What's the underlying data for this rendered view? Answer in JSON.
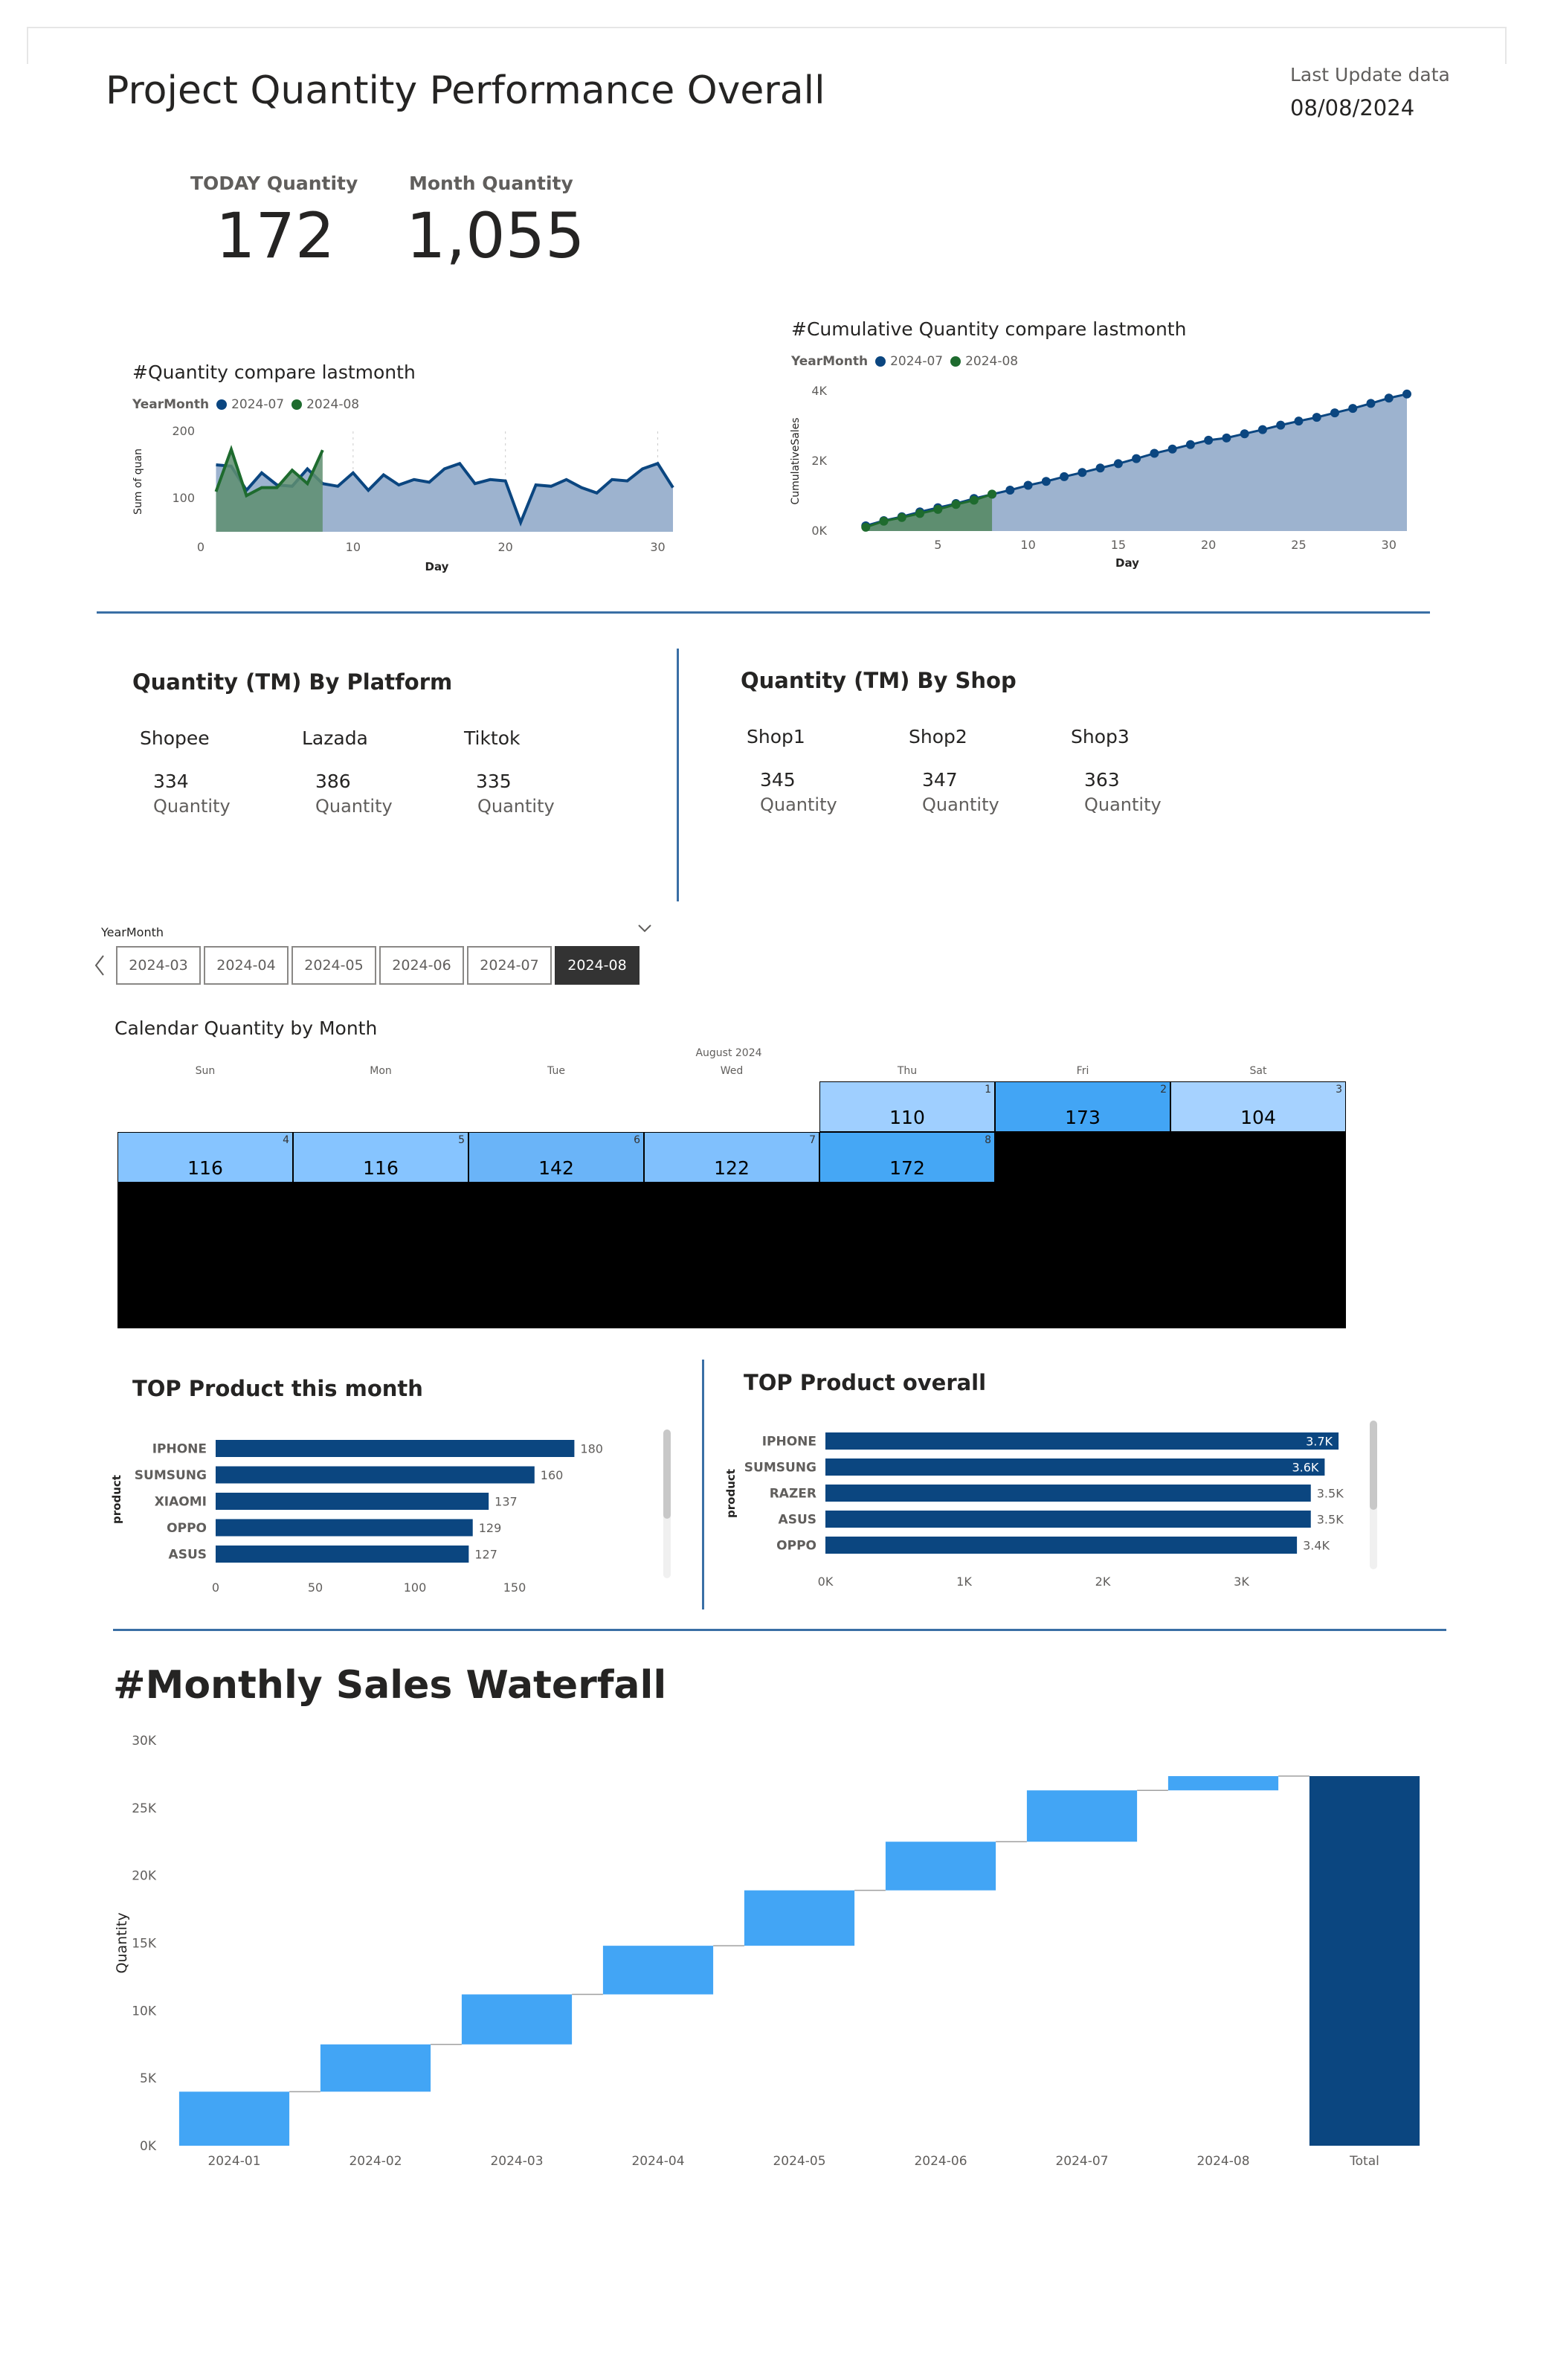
{
  "header": {
    "title": "Project Quantity Performance Overall",
    "last_update_label": "Last Update data",
    "last_update_value": "08/08/2024"
  },
  "kpis": {
    "today_label": "TODAY Quantity",
    "today_value": "172",
    "month_label": "Month Quantity",
    "month_value": "1,055"
  },
  "legend": {
    "label": "YearMonth",
    "series1": "2024-07",
    "series2": "2024-08"
  },
  "colors": {
    "dark_blue": "#0b4680",
    "green": "#1e6b2e",
    "light_fill": "#9db3cf",
    "bright_blue": "#42a5f5",
    "divider": "#3a6fa5"
  },
  "chart_data": [
    {
      "type": "line",
      "title": "#Quantity compare lastmonth",
      "xlabel": "Day",
      "ylabel": "Sum of quan",
      "xlim": [
        0,
        31
      ],
      "ylim": [
        50,
        200
      ],
      "xticks": [
        0,
        10,
        20,
        30
      ],
      "yticks": [
        100,
        200
      ],
      "series": [
        {
          "name": "2024-07",
          "x": [
            1,
            2,
            3,
            4,
            5,
            6,
            7,
            8,
            9,
            10,
            11,
            12,
            13,
            14,
            15,
            16,
            17,
            18,
            19,
            20,
            21,
            22,
            23,
            24,
            25,
            26,
            27,
            28,
            29,
            30,
            31
          ],
          "values": [
            150,
            148,
            112,
            138,
            120,
            118,
            144,
            122,
            118,
            138,
            112,
            135,
            120,
            128,
            124,
            144,
            152,
            122,
            128,
            126,
            64,
            120,
            118,
            128,
            116,
            108,
            128,
            126,
            144,
            152,
            116
          ]
        },
        {
          "name": "2024-08",
          "x": [
            1,
            2,
            3,
            4,
            5,
            6,
            7,
            8
          ],
          "values": [
            110,
            173,
            104,
            116,
            116,
            142,
            122,
            172
          ]
        }
      ]
    },
    {
      "type": "area",
      "title": "#Cumulative Quantity compare lastmonth",
      "xlabel": "Day",
      "ylabel": "CumulativeSales",
      "xlim": [
        0,
        31
      ],
      "ylim": [
        0,
        4000
      ],
      "xticks": [
        5,
        10,
        15,
        20,
        25,
        30
      ],
      "ytick_labels": [
        "0K",
        "2K",
        "4K"
      ],
      "series": [
        {
          "name": "2024-07",
          "x": [
            1,
            2,
            3,
            4,
            5,
            6,
            7,
            8,
            9,
            10,
            11,
            12,
            13,
            14,
            15,
            16,
            17,
            18,
            19,
            20,
            21,
            22,
            23,
            24,
            25,
            26,
            27,
            28,
            29,
            30,
            31
          ],
          "values": [
            150,
            298,
            410,
            548,
            668,
            786,
            930,
            1052,
            1170,
            1308,
            1420,
            1555,
            1675,
            1803,
            1927,
            2071,
            2223,
            2345,
            2473,
            2599,
            2663,
            2783,
            2901,
            3029,
            3145,
            3253,
            3381,
            3507,
            3651,
            3803,
            3919
          ]
        },
        {
          "name": "2024-08",
          "x": [
            1,
            2,
            3,
            4,
            5,
            6,
            7,
            8
          ],
          "values": [
            110,
            283,
            387,
            503,
            619,
            761,
            883,
            1055
          ]
        }
      ]
    },
    {
      "type": "bar",
      "title": "TOP Product this month",
      "ylabel": "product",
      "categories": [
        "IPHONE",
        "SUMSUNG",
        "XIAOMI",
        "OPPO",
        "ASUS"
      ],
      "values": [
        180,
        160,
        137,
        129,
        127
      ],
      "data_labels": [
        "180",
        "160",
        "137",
        "129",
        "127"
      ],
      "xlim": [
        0,
        200
      ],
      "xticks": [
        0,
        50,
        100,
        150
      ]
    },
    {
      "type": "bar",
      "title": "TOP Product overall",
      "ylabel": "product",
      "categories": [
        "IPHONE",
        "SUMSUNG",
        "RAZER",
        "ASUS",
        "OPPO"
      ],
      "values": [
        3700,
        3600,
        3500,
        3500,
        3400
      ],
      "data_labels": [
        "3.7K",
        "3.6K",
        "3.5K",
        "3.5K",
        "3.4K"
      ],
      "xlim": [
        0,
        4000
      ],
      "xticks": [
        0,
        1000,
        2000,
        3000
      ],
      "xtick_labels": [
        "0K",
        "1K",
        "2K",
        "3K"
      ]
    },
    {
      "type": "bar",
      "title": "#Monthly Sales Waterfall",
      "ylabel": "Quantity",
      "categories": [
        "2024-01",
        "2024-02",
        "2024-03",
        "2024-04",
        "2024-05",
        "2024-06",
        "2024-07",
        "2024-08",
        "Total"
      ],
      "increments": [
        4000,
        3500,
        3700,
        3600,
        4100,
        3600,
        3800,
        1055
      ],
      "total": 27355,
      "ylim": [
        0,
        30000
      ],
      "yticks": [
        0,
        5000,
        10000,
        15000,
        20000,
        25000,
        30000
      ],
      "ytick_labels": [
        "0K",
        "5K",
        "10K",
        "15K",
        "20K",
        "25K",
        "30K"
      ]
    }
  ],
  "platform": {
    "title": "Quantity (TM) By Platform",
    "cards": [
      {
        "name": "Shopee",
        "value": "334",
        "sub": "Quantity"
      },
      {
        "name": "Lazada",
        "value": "386",
        "sub": "Quantity"
      },
      {
        "name": "Tiktok",
        "value": "335",
        "sub": "Quantity"
      }
    ]
  },
  "shop": {
    "title": "Quantity (TM) By Shop",
    "cards": [
      {
        "name": "Shop1",
        "value": "345",
        "sub": "Quantity"
      },
      {
        "name": "Shop2",
        "value": "347",
        "sub": "Quantity"
      },
      {
        "name": "Shop3",
        "value": "363",
        "sub": "Quantity"
      }
    ]
  },
  "slicer": {
    "label": "YearMonth",
    "options": [
      "2024-03",
      "2024-04",
      "2024-05",
      "2024-06",
      "2024-07",
      "2024-08"
    ],
    "selected": "2024-08"
  },
  "calendar": {
    "title": "Calendar Quantity by Month",
    "month_label": "August 2024",
    "days_of_week": [
      "Sun",
      "Mon",
      "Tue",
      "Wed",
      "Thu",
      "Fri",
      "Sat"
    ],
    "days": [
      {
        "day": "1",
        "value": "110",
        "color": "#9fcfff"
      },
      {
        "day": "2",
        "value": "173",
        "color": "#42a5f5"
      },
      {
        "day": "3",
        "value": "104",
        "color": "#a6d2ff"
      },
      {
        "day": "4",
        "value": "116",
        "color": "#86c4ff"
      },
      {
        "day": "5",
        "value": "116",
        "color": "#86c4ff"
      },
      {
        "day": "6",
        "value": "142",
        "color": "#6ab4f8"
      },
      {
        "day": "7",
        "value": "122",
        "color": "#80c0fd"
      },
      {
        "day": "8",
        "value": "172",
        "color": "#45a7f5"
      }
    ]
  }
}
